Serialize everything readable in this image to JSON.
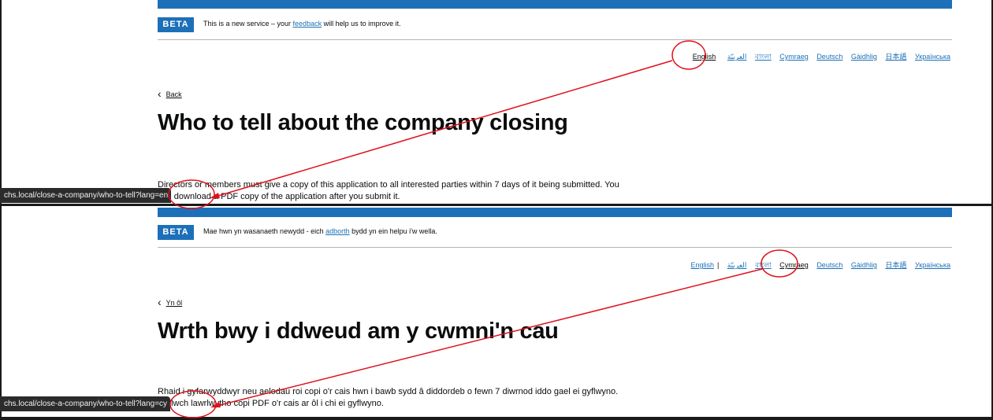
{
  "top": {
    "phase_tag": "BETA",
    "phase_before": "This is a new service – your ",
    "phase_link": "feedback",
    "phase_after": " will help us to improve it.",
    "languages": [
      "English",
      "العربيّة",
      "বাংলা",
      "Cymraeg",
      "Deutsch",
      "Gàidhlig",
      "日本語",
      "Українська"
    ],
    "back_label": "Back",
    "title": "Who to tell about the company closing",
    "body_line1": "Directors or members must give a copy of this application to all interested parties within 7 days of it being submitted. You",
    "body_line2": "can download a PDF copy of the application after you submit it.",
    "status_url": "chs.local/close-a-company/who-to-tell?lang=en"
  },
  "bottom": {
    "phase_tag": "BETA",
    "phase_before": "Mae hwn yn wasanaeth newydd - eich ",
    "phase_link": "adborth",
    "phase_after": " bydd yn ein helpu i'w wella.",
    "languages": [
      "English",
      "العربيّة",
      "বাংলা",
      "Cymraeg",
      "Deutsch",
      "Gàidhlig",
      "日本語",
      "Українська"
    ],
    "back_label": "Yn ôl",
    "title": "Wrth bwy i ddweud am y cwmni'n cau",
    "body_line1": "Rhaid i gyfarwyddwyr neu aelodau roi copi o'r cais hwn i bawb sydd â diddordeb o fewn 7 diwrnod iddo gael ei gyflwyno.",
    "body_line2": "Gallwch lawrlwytho copi PDF o'r cais ar ôl i chi ei gyflwyno.",
    "status_url": "chs.local/close-a-company/who-to-tell?lang=cy"
  },
  "colors": {
    "govuk_blue": "#1d70b8",
    "annotation_red": "#e0101b",
    "status_bg": "#2b2b2b"
  }
}
